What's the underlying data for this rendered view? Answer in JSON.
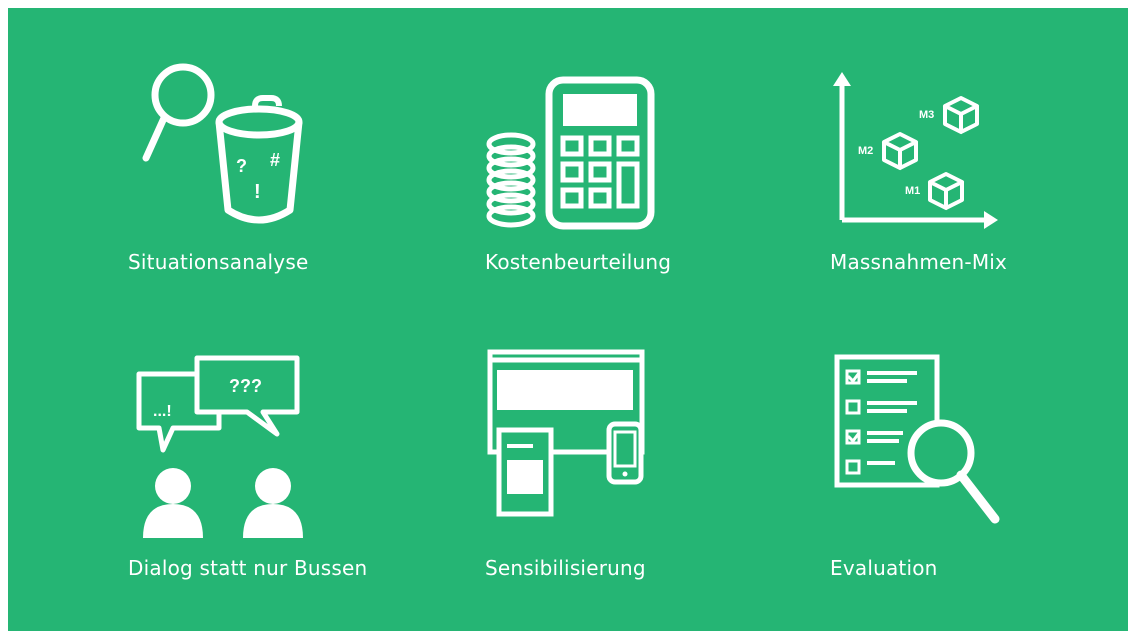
{
  "colors": {
    "background": "#25b574",
    "foreground": "#ffffff",
    "frame": "#ffffff"
  },
  "tiles": [
    {
      "label": "Situationsanalyse",
      "icon": "magnifier-trash-icon",
      "bin_marks": [
        "?",
        "#",
        "!"
      ]
    },
    {
      "label": "Kostenbeurteilung",
      "icon": "calculator-coins-icon"
    },
    {
      "label": "Massnahmen-Mix",
      "icon": "measures-chart-icon",
      "points": [
        "M3",
        "M2",
        "M1"
      ]
    },
    {
      "label": "Dialog statt nur Bussen",
      "icon": "dialog-people-icon",
      "bubbles": [
        "...!",
        "???"
      ]
    },
    {
      "label": "Sensibilisierung",
      "icon": "devices-icon"
    },
    {
      "label": "Evaluation",
      "icon": "checklist-magnifier-icon"
    }
  ]
}
